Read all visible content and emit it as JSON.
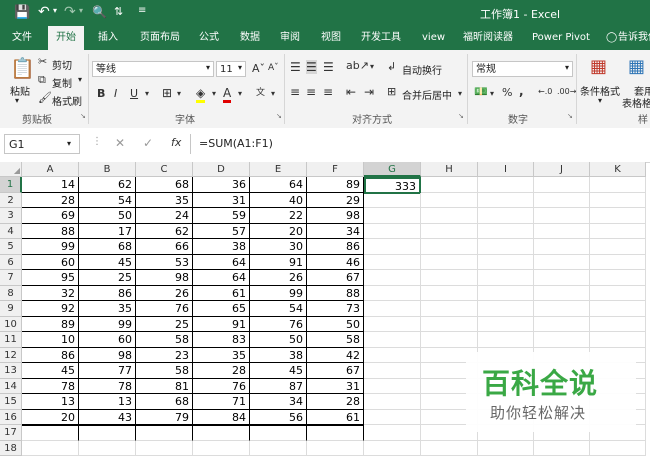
{
  "titlebar": {
    "title": "工作簿1 - Excel"
  },
  "tabs": [
    "文件",
    "开始",
    "插入",
    "页面布局",
    "公式",
    "数据",
    "审阅",
    "视图",
    "开发工具",
    "view",
    "福昕阅读器",
    "Power Pivot",
    "告诉我你..."
  ],
  "ribbon": {
    "paste": "粘贴",
    "cut": "剪切",
    "copy": "复制",
    "format_painter": "格式刷",
    "clipboard": "剪贴板",
    "font_name": "等线",
    "font_size": "11",
    "font_group": "字体",
    "wrap_text": "自动换行",
    "merge_center": "合并后居中",
    "alignment": "对齐方式",
    "number_format": "常规",
    "number_group": "数字",
    "conditional_format": "条件格式",
    "table_format_1": "套用",
    "table_format_2": "表格格式",
    "styles_group": "样"
  },
  "formula_bar": {
    "name_box": "G1",
    "fx": "fx",
    "formula": "=SUM(A1:F1)"
  },
  "columns": [
    "A",
    "B",
    "C",
    "D",
    "E",
    "F",
    "G",
    "H",
    "I",
    "J",
    "K"
  ],
  "rows": [
    "1",
    "2",
    "3",
    "4",
    "5",
    "6",
    "7",
    "8",
    "9",
    "10",
    "11",
    "12",
    "13",
    "14",
    "15",
    "16",
    "17",
    "18"
  ],
  "cells": [
    [
      14,
      62,
      68,
      36,
      64,
      89
    ],
    [
      28,
      54,
      35,
      31,
      40,
      29
    ],
    [
      69,
      50,
      24,
      59,
      22,
      98
    ],
    [
      88,
      17,
      62,
      57,
      20,
      34
    ],
    [
      99,
      68,
      66,
      38,
      30,
      86
    ],
    [
      60,
      45,
      53,
      64,
      91,
      46
    ],
    [
      95,
      25,
      98,
      64,
      26,
      67
    ],
    [
      32,
      86,
      26,
      61,
      99,
      88
    ],
    [
      92,
      35,
      76,
      65,
      54,
      73
    ],
    [
      89,
      99,
      25,
      91,
      76,
      50
    ],
    [
      10,
      60,
      58,
      83,
      50,
      58
    ],
    [
      86,
      98,
      23,
      35,
      38,
      42
    ],
    [
      45,
      77,
      58,
      28,
      45,
      67
    ],
    [
      78,
      78,
      81,
      76,
      87,
      31
    ],
    [
      13,
      13,
      68,
      71,
      34,
      28
    ],
    [
      20,
      43,
      79,
      84,
      56,
      61
    ]
  ],
  "g1_value": "333",
  "watermark": {
    "line1": "百科全说",
    "line2": "助你轻松解决"
  },
  "colors": {
    "excel_green": "#217346",
    "watermark_green": "#3aa845"
  }
}
